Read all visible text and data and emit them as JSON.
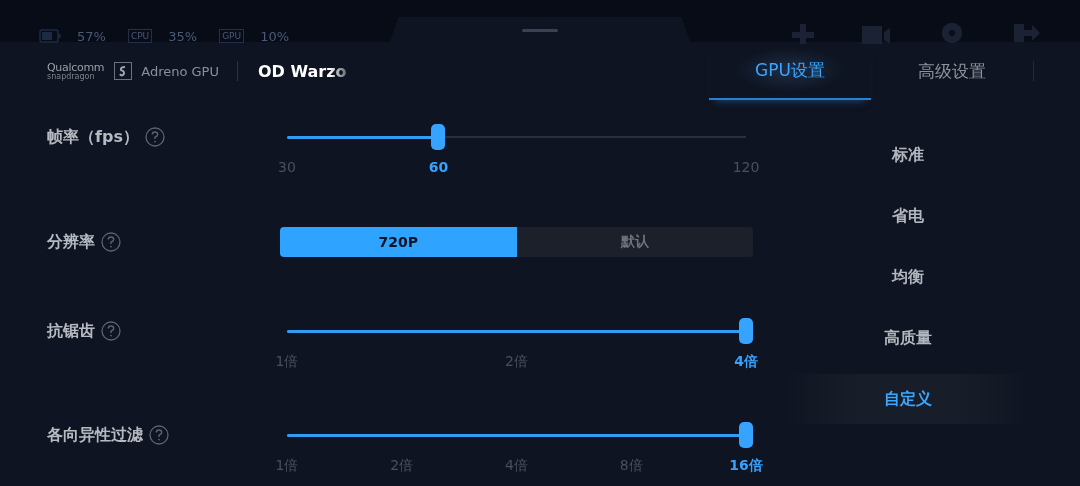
{
  "status_bar": {
    "items": [
      {
        "kind": "battery",
        "value": "57%"
      },
      {
        "kind": "chip",
        "tag": "CPU",
        "value": "35%"
      },
      {
        "kind": "chip",
        "tag": "GPU",
        "value": "10%"
      }
    ]
  },
  "header": {
    "brand": {
      "name": "Qualcomm",
      "sub": "snapdragon"
    },
    "gpu_name": "Adreno GPU",
    "game_title": "OD Warzo"
  },
  "tabs": [
    {
      "label": "GPU设置",
      "selected": true
    },
    {
      "label": "高级设置",
      "selected": false
    }
  ],
  "settings": [
    {
      "kind": "slider",
      "label": "帧率（fps）",
      "level": 0.33,
      "ticks": [
        {
          "label": "30",
          "selected": false
        },
        {
          "label": "60",
          "selected": true
        },
        {
          "label": "120",
          "selected": false
        }
      ]
    },
    {
      "kind": "segmented",
      "label": "分辨率",
      "options": [
        {
          "label": "720P",
          "selected": true
        },
        {
          "label": "默认",
          "selected": false
        }
      ]
    },
    {
      "kind": "slider",
      "label": "抗锯齿",
      "level": 1,
      "ticks": [
        {
          "label": "1倍",
          "selected": false
        },
        {
          "label": "2倍",
          "selected": false
        },
        {
          "label": "4倍",
          "selected": true
        }
      ]
    },
    {
      "kind": "slider",
      "label": "各向异性过滤",
      "level": 1,
      "ticks": [
        {
          "label": "1倍",
          "selected": false
        },
        {
          "label": "2倍",
          "selected": false
        },
        {
          "label": "4倍",
          "selected": false
        },
        {
          "label": "8倍",
          "selected": false
        },
        {
          "label": "16倍",
          "selected": true
        }
      ]
    }
  ],
  "presets": [
    {
      "label": "标准",
      "selected": false
    },
    {
      "label": "省电",
      "selected": false
    },
    {
      "label": "均衡",
      "selected": false
    },
    {
      "label": "高质量",
      "selected": false
    },
    {
      "label": "自定义",
      "selected": true
    }
  ]
}
